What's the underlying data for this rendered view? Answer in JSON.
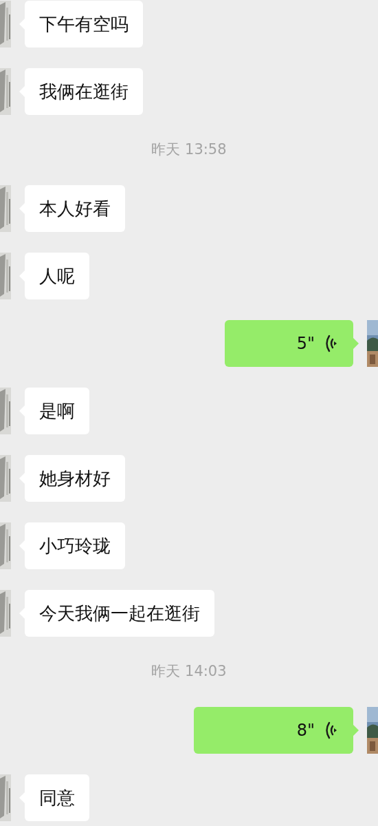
{
  "messages": [
    {
      "kind": "text",
      "outgoing": false,
      "text": "下午有空吗"
    },
    {
      "kind": "text",
      "outgoing": false,
      "text": "我俩在逛街"
    },
    {
      "kind": "time",
      "text": "昨天 13:58"
    },
    {
      "kind": "text",
      "outgoing": false,
      "text": "本人好看"
    },
    {
      "kind": "text",
      "outgoing": false,
      "text": "人呢"
    },
    {
      "kind": "voice",
      "outgoing": true,
      "text": "5\""
    },
    {
      "kind": "text",
      "outgoing": false,
      "text": "是啊"
    },
    {
      "kind": "text",
      "outgoing": false,
      "text": "她身材好"
    },
    {
      "kind": "text",
      "outgoing": false,
      "text": "小巧玲珑"
    },
    {
      "kind": "text",
      "outgoing": false,
      "text": "今天我俩一起在逛街"
    },
    {
      "kind": "time",
      "text": "昨天 14:03"
    },
    {
      "kind": "voice",
      "outgoing": true,
      "text": "8\""
    },
    {
      "kind": "text",
      "outgoing": false,
      "text": "同意"
    }
  ]
}
